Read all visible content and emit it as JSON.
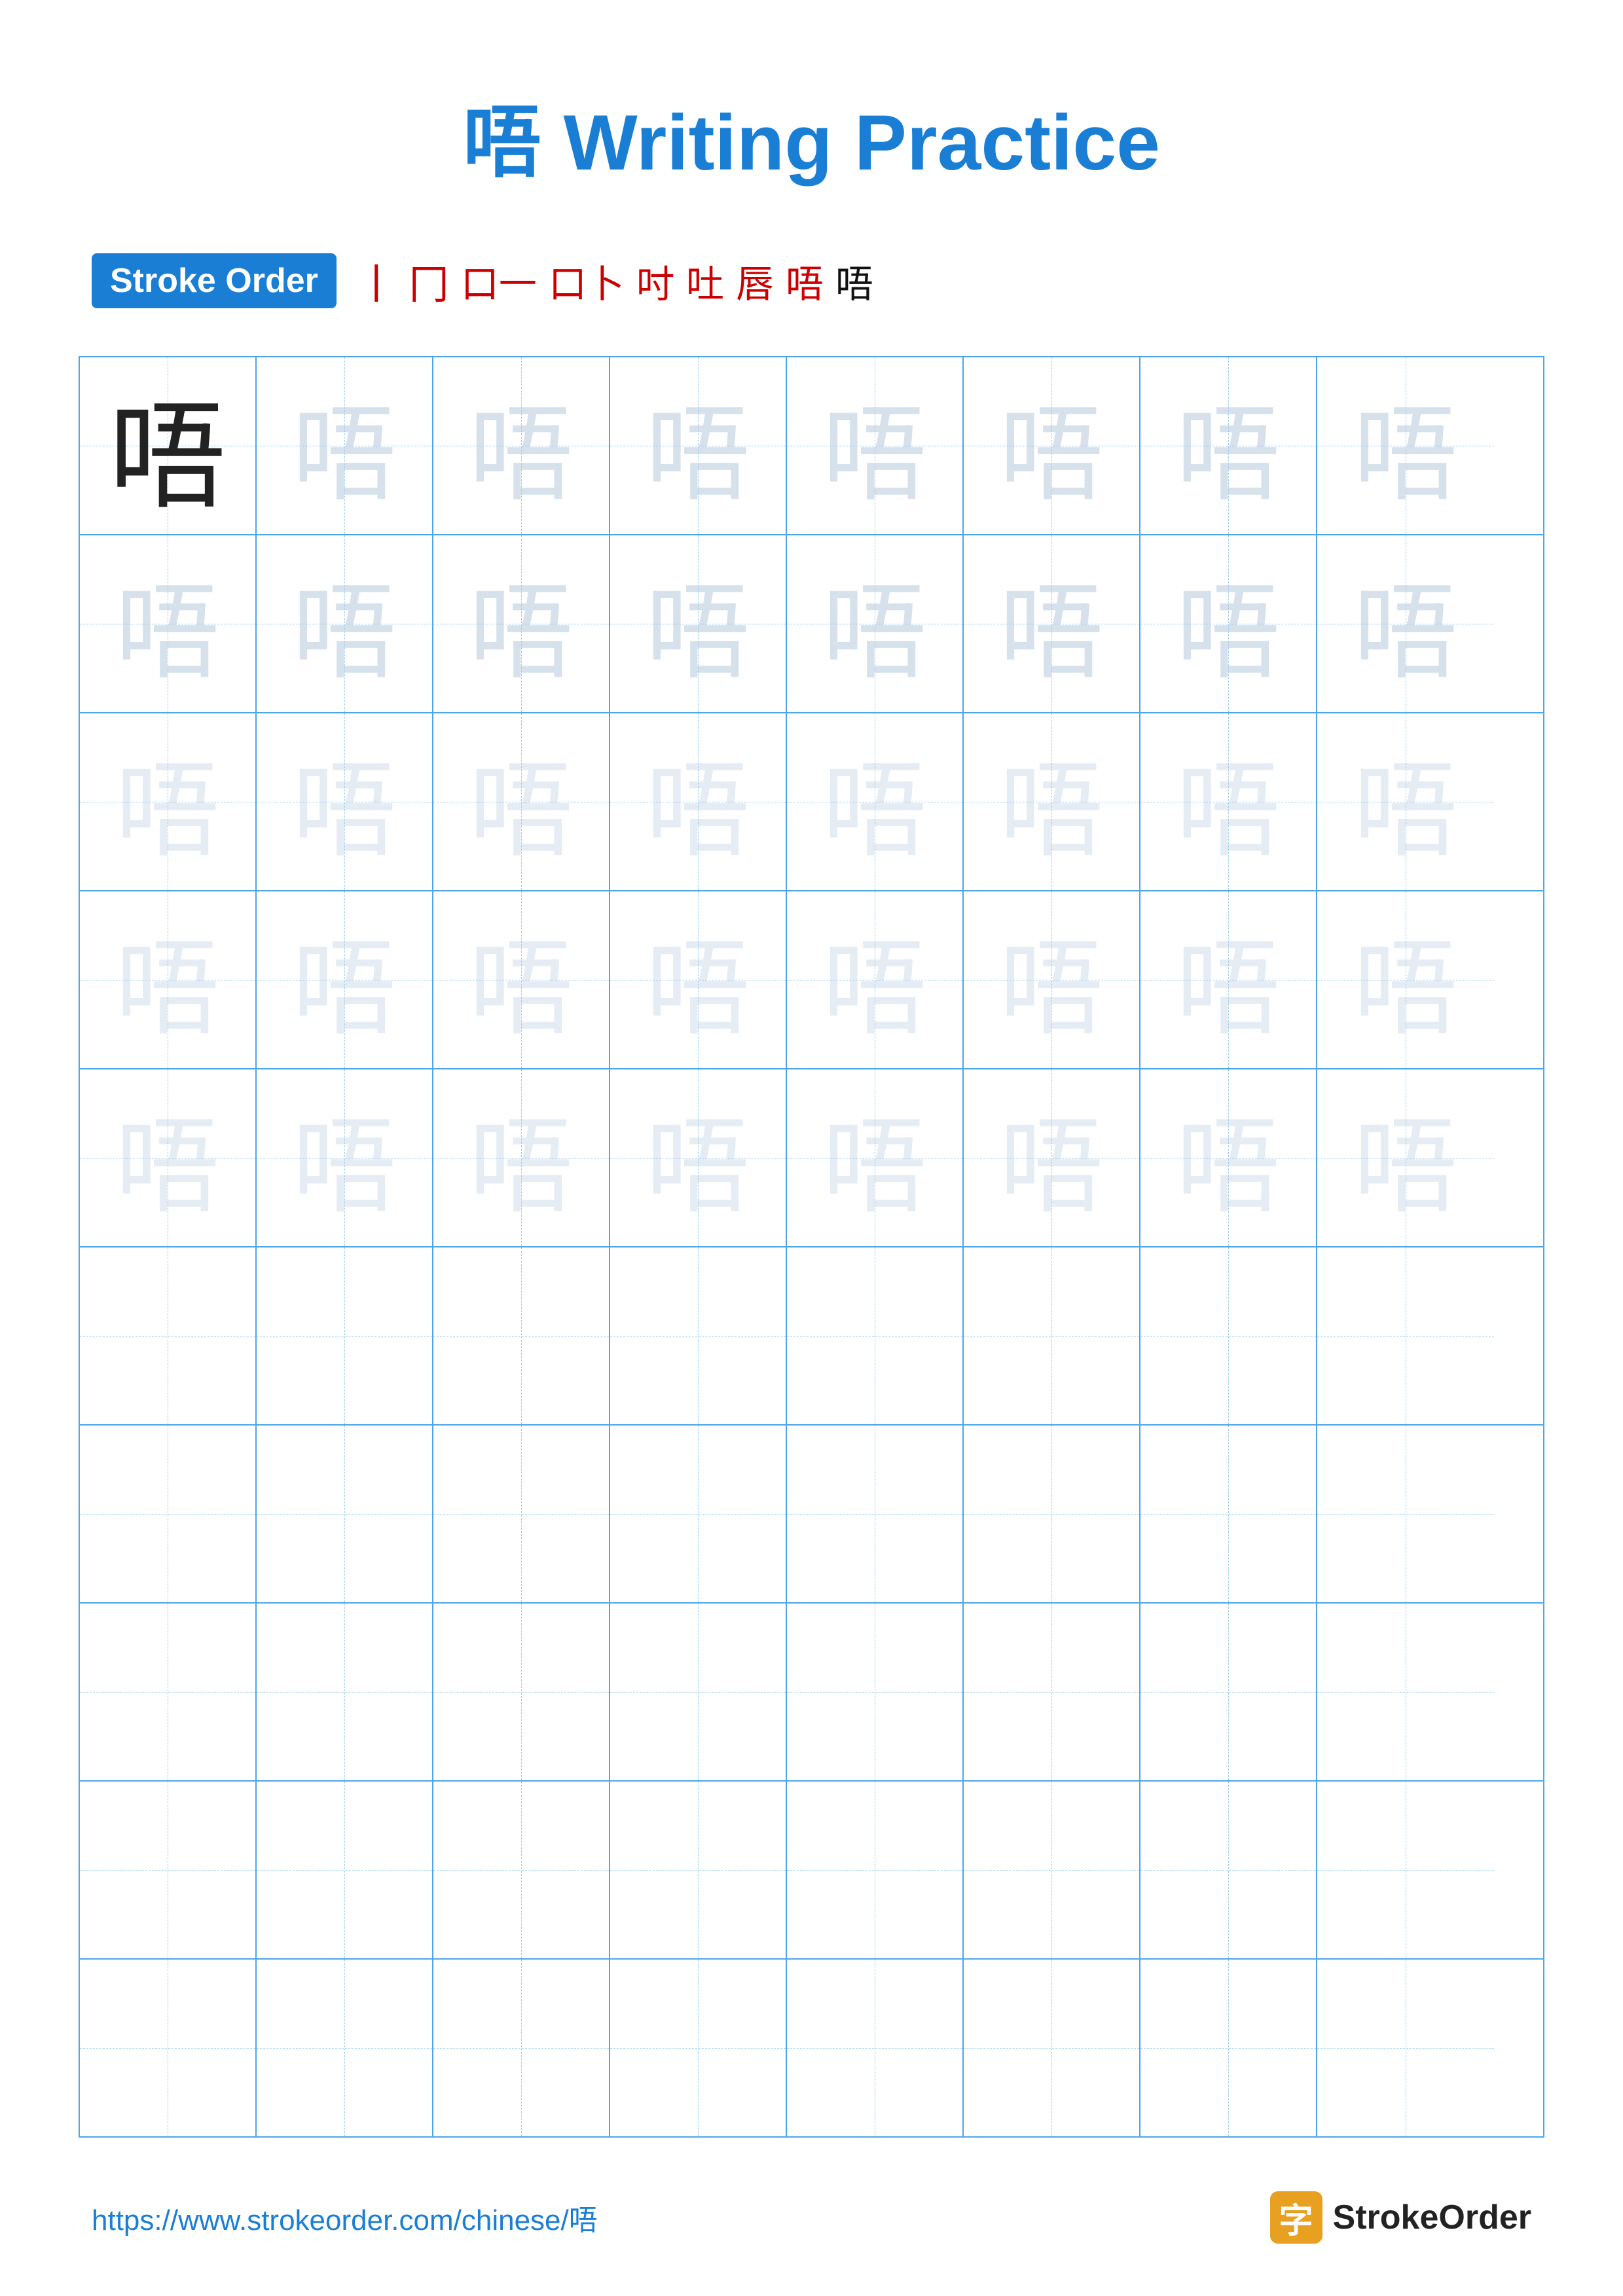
{
  "page": {
    "title": "唔 Writing Practice",
    "title_char": "唔",
    "title_text": "Writing Practice"
  },
  "stroke_order": {
    "badge_label": "Stroke Order",
    "strokes": [
      "丨",
      "冂",
      "冂一",
      "冂卜",
      "冂吋",
      "冂吐",
      "冂唇",
      "冂唔",
      "唔"
    ]
  },
  "character": "唔",
  "grid": {
    "cols": 8,
    "practice_rows": 5,
    "empty_rows": 5
  },
  "footer": {
    "url": "https://www.strokeorder.com/chinese/唔",
    "logo_text": "StrokeOrder",
    "logo_char": "字"
  }
}
